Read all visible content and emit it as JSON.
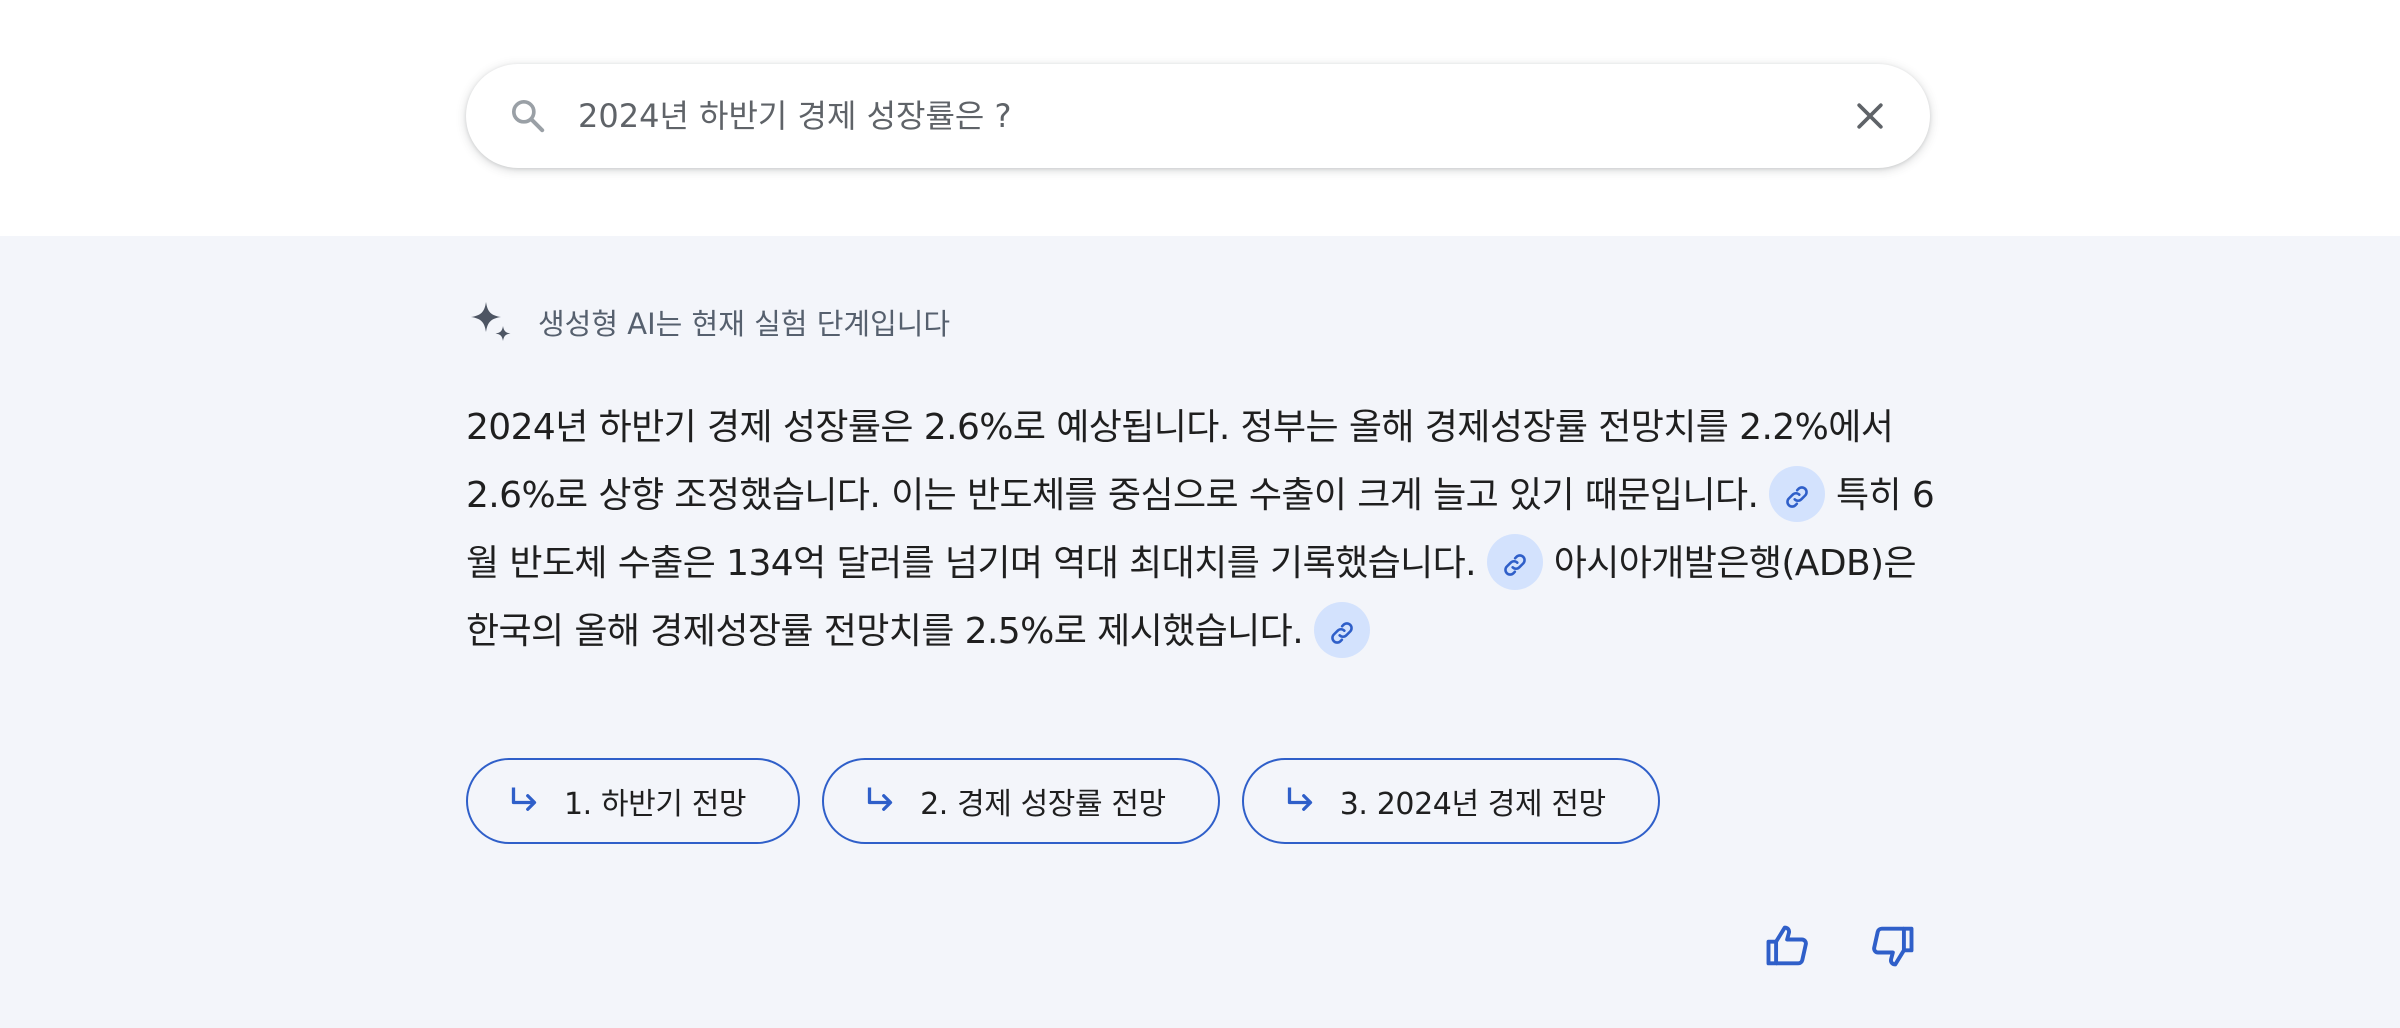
{
  "search": {
    "query": "2024년 하반기 경제 성장률은 ?",
    "search_icon": "search-icon",
    "clear_icon": "close-icon"
  },
  "notice": {
    "icon": "sparkle-icon",
    "text": "생성형 AI는 현재 실험 단계입니다"
  },
  "answer": {
    "sentence_1": "2024년 하반기 경제 성장률은 2.6%로 예상됩니다. 정부는 올해 경제성장률 전망치를 2.2%에서 2.6%로 상향 조정했습니다. 이는 반도체를 중심으로 수출이 크게 늘고 있기 때문입니다.",
    "sentence_2": "특히 6월 반도체 수출은 134억 달러를 넘기며 역대 최대치를 기록했습니다.",
    "sentence_3": "아시아개발은행(ADB)은 한국의 올해 경제성장률 전망치를 2.5%로 제시했습니다.",
    "link_icon": "link-icon"
  },
  "suggestions": [
    {
      "label": "1. 하반기 전망",
      "icon": "subdirectory-arrow-icon"
    },
    {
      "label": "2. 경제 성장률 전망",
      "icon": "subdirectory-arrow-icon"
    },
    {
      "label": "3. 2024년 경제 전망",
      "icon": "subdirectory-arrow-icon"
    }
  ],
  "feedback": {
    "like_icon": "thumbs-up-icon",
    "dislike_icon": "thumbs-down-icon"
  },
  "colors": {
    "accent": "#2f5fc9",
    "panel_bg": "#f3f5fa",
    "link_chip_bg": "#d3e2fd",
    "text": "#1f1f1f",
    "muted_text": "#56606e"
  }
}
